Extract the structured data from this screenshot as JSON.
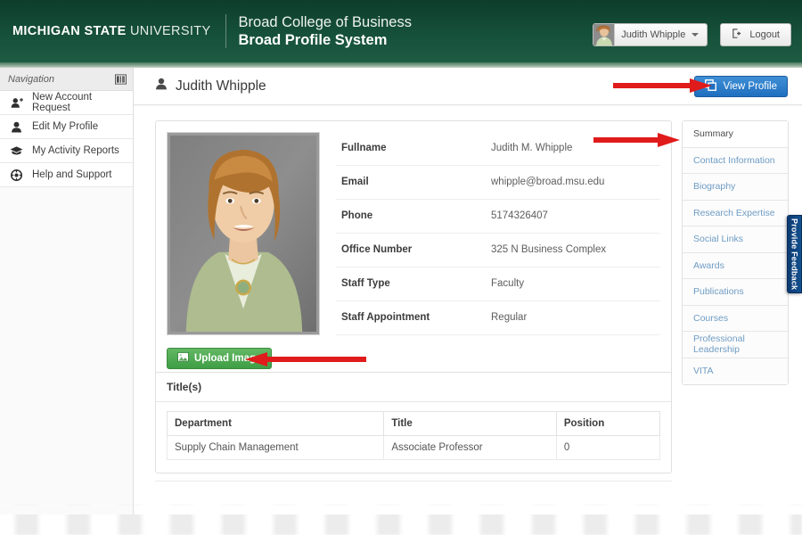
{
  "header": {
    "university_bold": "MICHIGAN STATE",
    "university_light": " UNIVERSITY",
    "college": "Broad College of Business",
    "system": "Broad Profile System",
    "user_name": "Judith Whipple",
    "logout_label": "Logout"
  },
  "left_nav": {
    "title": "Navigation",
    "items": [
      {
        "label": "New Account Request",
        "icon": "user-add-icon"
      },
      {
        "label": "Edit My Profile",
        "icon": "user-icon"
      },
      {
        "label": "My Activity Reports",
        "icon": "graduation-cap-icon"
      },
      {
        "label": "Help and Support",
        "icon": "life-ring-icon"
      }
    ]
  },
  "page": {
    "title": "Judith Whipple",
    "view_profile_label": "View Profile"
  },
  "profile": {
    "fields": [
      {
        "key": "Fullname",
        "value": "Judith M. Whipple"
      },
      {
        "key": "Email",
        "value": "whipple@broad.msu.edu"
      },
      {
        "key": "Phone",
        "value": "5174326407"
      },
      {
        "key": "Office Number",
        "value": "325 N Business Complex"
      },
      {
        "key": "Staff Type",
        "value": "Faculty"
      },
      {
        "key": "Staff Appointment",
        "value": "Regular"
      }
    ],
    "upload_label": "Upload Image"
  },
  "titles_panel": {
    "heading": "Title(s)",
    "columns": [
      "Department",
      "Title",
      "Position"
    ],
    "rows": [
      [
        "Supply Chain Management",
        "Associate Professor",
        "0"
      ]
    ]
  },
  "right_nav": {
    "items": [
      {
        "label": "Summary",
        "active": true
      },
      {
        "label": "Contact Information",
        "active": false
      },
      {
        "label": "Biography",
        "active": false
      },
      {
        "label": "Research Expertise",
        "active": false
      },
      {
        "label": "Social Links",
        "active": false
      },
      {
        "label": "Awards",
        "active": false
      },
      {
        "label": "Publications",
        "active": false
      },
      {
        "label": "Courses",
        "active": false
      },
      {
        "label": "Professional Leadership",
        "active": false
      },
      {
        "label": "VITA",
        "active": false
      }
    ]
  },
  "feedback": {
    "label": "Provide Feedback"
  },
  "colors": {
    "header_green": "#16503a",
    "accent_green": "#87a691",
    "primary_blue": "#1f6fc0",
    "upload_green": "#3f9e45",
    "link_blue": "#6f9cc4",
    "annotation_red": "#e01b1b"
  }
}
